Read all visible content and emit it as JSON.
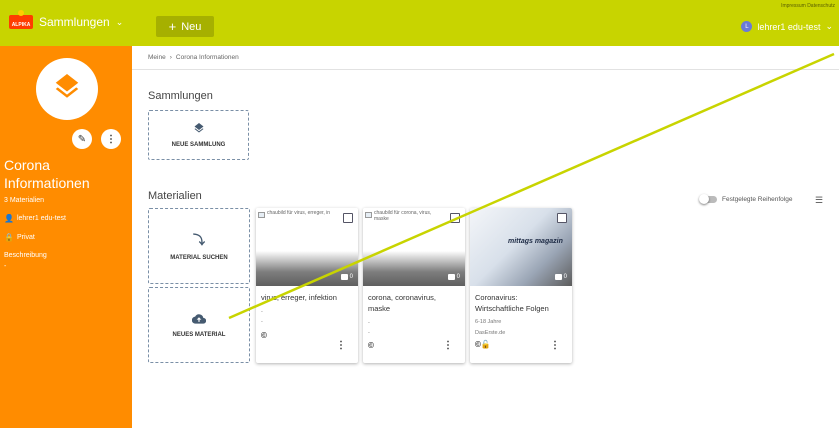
{
  "header": {
    "logo_text": "ALPIKA",
    "collections_label": "Sammlungen",
    "new_button_label": "Neu",
    "links_text": "Impressum  Datenschutz",
    "user_initial": "L",
    "user_name": "lehrer1 edu-test",
    "accent_color": "#c8d400"
  },
  "sidebar": {
    "title": "Corona Informationen",
    "material_count": "3 Materialien",
    "owner": "lehrer1 edu-test",
    "visibility": "Privat",
    "description_label": "Beschreibung",
    "description_value": "-",
    "color": "#ff8c00"
  },
  "breadcrumb": {
    "root": "Meine",
    "current": "Corona Informationen"
  },
  "collections_section": {
    "heading": "Sammlungen",
    "new_collection_label": "NEUE SAMMLUNG"
  },
  "materials_section": {
    "heading": "Materialien",
    "search_material_label": "MATERIAL SUCHEN",
    "new_material_label": "NEUES MATERIAL",
    "sort_toggle_label": "Festgelegte Reihenfolge"
  },
  "cards": [
    {
      "image_alt": "chaubild für virus, erreger, in",
      "comments": "0",
      "title": "virus, erreger, infektion",
      "line1": "-",
      "line2": "-",
      "license": "©"
    },
    {
      "image_alt": "chaubild für corona, virus, maske",
      "comments": "0",
      "title": "corona, coronavirus, maske",
      "line1": "-",
      "line2": "-",
      "license": "©"
    },
    {
      "image_text": "mittags magazin",
      "comments": "0",
      "title": "Coronavirus: Wirtschaftliche Folgen",
      "line1": "6-18 Jahre",
      "line2": "DasErste.de",
      "license": "©🔓"
    }
  ]
}
